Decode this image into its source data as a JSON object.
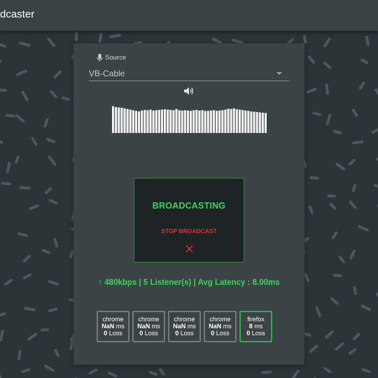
{
  "app": {
    "title_visible": "dcaster"
  },
  "source": {
    "label": "Source",
    "selected": "VB-Cable"
  },
  "audio": {
    "level_bars": [
      0.87,
      0.84,
      0.83,
      0.82,
      0.8,
      0.78,
      0.76,
      0.74,
      0.72,
      0.7,
      0.73,
      0.75,
      0.74,
      0.76,
      0.73,
      0.74,
      0.75,
      0.76,
      0.77,
      0.76,
      0.75,
      0.74,
      0.78,
      0.74,
      0.73,
      0.74,
      0.73,
      0.72,
      0.74,
      0.75,
      0.73,
      0.74,
      0.72,
      0.72,
      0.73,
      0.74,
      0.72,
      0.73,
      0.74,
      0.76,
      0.79,
      0.78,
      0.8,
      0.77,
      0.76,
      0.75,
      0.73,
      0.72,
      0.7,
      0.69,
      0.68,
      0.67,
      0.66,
      0.65
    ]
  },
  "broadcast": {
    "status": "BROADCASTING",
    "stop_label": "STOP BROADCAST"
  },
  "stats": {
    "text": "↑ 480kbps | 5 Listener(s) | Avg Latency : 8.00ms"
  },
  "listeners": [
    {
      "browser": "chrome",
      "latency": "NaN",
      "latency_unit": "ms",
      "loss": "0",
      "loss_label": "Loss",
      "status": "inactive"
    },
    {
      "browser": "chrome",
      "latency": "NaN",
      "latency_unit": "ms",
      "loss": "0",
      "loss_label": "Loss",
      "status": "inactive"
    },
    {
      "browser": "chrome",
      "latency": "NaN",
      "latency_unit": "ms",
      "loss": "0",
      "loss_label": "Loss",
      "status": "inactive"
    },
    {
      "browser": "chrome",
      "latency": "NaN",
      "latency_unit": "ms",
      "loss": "0",
      "loss_label": "Loss",
      "status": "inactive"
    },
    {
      "browser": "firefox",
      "latency": "8",
      "latency_unit": "ms",
      "loss": "0",
      "loss_label": "Loss",
      "status": "active"
    }
  ],
  "colors": {
    "accent": "#3ad657",
    "danger": "#e0342e",
    "background": "#2c3438",
    "panel": "#3c4347",
    "confetti": "#4c585e"
  }
}
